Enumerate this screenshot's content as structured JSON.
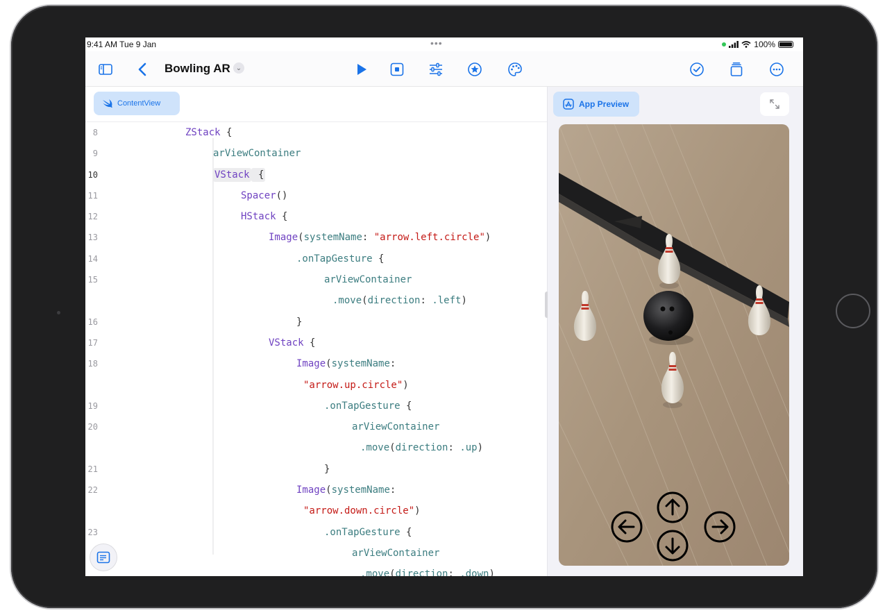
{
  "status_bar": {
    "time": "9:41 AM  Tue 9 Jan",
    "dots": "•••",
    "battery": "100%"
  },
  "toolbar": {
    "project_title": "Bowling AR",
    "icons": [
      "sidebar-icon",
      "back-chevron-icon",
      "play-icon",
      "stop-icon",
      "sliders-icon",
      "star-icon",
      "palette-icon",
      "checkmark-circle-icon",
      "stack-icon",
      "ellipsis-circle-icon"
    ]
  },
  "editor": {
    "tab_label": "ContentView",
    "current_line": "10",
    "lines": [
      {
        "num": "8",
        "indent": 0,
        "parts": [
          {
            "t": "ZStack",
            "c": "kw"
          },
          {
            "t": " {",
            "c": "plain"
          }
        ]
      },
      {
        "num": "9",
        "indent": 1,
        "parts": [
          {
            "t": "arViewContainer",
            "c": "var"
          }
        ]
      },
      {
        "num": "10",
        "indent": 1,
        "parts": [
          {
            "t": "VStack",
            "c": "kw",
            "hl": true
          },
          {
            "t": " {",
            "c": "plain",
            "hl": true
          }
        ]
      },
      {
        "num": "11",
        "indent": 2,
        "parts": [
          {
            "t": "Spacer",
            "c": "kw"
          },
          {
            "t": "()",
            "c": "plain"
          }
        ]
      },
      {
        "num": "12",
        "indent": 2,
        "parts": [
          {
            "t": "HStack",
            "c": "kw"
          },
          {
            "t": " {",
            "c": "plain"
          }
        ]
      },
      {
        "num": "13",
        "indent": 3,
        "parts": [
          {
            "t": "Image",
            "c": "kw"
          },
          {
            "t": "(",
            "c": "plain"
          },
          {
            "t": "systemName",
            "c": "var"
          },
          {
            "t": ": ",
            "c": "plain"
          },
          {
            "t": "\"arrow.left.circle\"",
            "c": "str"
          },
          {
            "t": ")",
            "c": "plain"
          }
        ]
      },
      {
        "num": "14",
        "indent": 4,
        "parts": [
          {
            "t": ".onTapGesture",
            "c": "var"
          },
          {
            "t": " {",
            "c": "plain"
          }
        ]
      },
      {
        "num": "15",
        "indent": 5,
        "parts": [
          {
            "t": "arViewContainer",
            "c": "var"
          }
        ]
      },
      {
        "num": "",
        "indent": 5.3,
        "parts": [
          {
            "t": ".move",
            "c": "var"
          },
          {
            "t": "(",
            "c": "plain"
          },
          {
            "t": "direction",
            "c": "var"
          },
          {
            "t": ": ",
            "c": "plain"
          },
          {
            "t": ".left",
            "c": "var"
          },
          {
            "t": ")",
            "c": "plain"
          }
        ]
      },
      {
        "num": "16",
        "indent": 4,
        "parts": [
          {
            "t": "}",
            "c": "plain"
          }
        ]
      },
      {
        "num": "17",
        "indent": 3,
        "parts": [
          {
            "t": "VStack",
            "c": "kw"
          },
          {
            "t": " {",
            "c": "plain"
          }
        ]
      },
      {
        "num": "18",
        "indent": 4,
        "parts": [
          {
            "t": "Image",
            "c": "kw"
          },
          {
            "t": "(",
            "c": "plain"
          },
          {
            "t": "systemName",
            "c": "var"
          },
          {
            "t": ":",
            "c": "plain"
          }
        ]
      },
      {
        "num": "",
        "indent": 4.25,
        "parts": [
          {
            "t": "\"arrow.up.circle\"",
            "c": "str"
          },
          {
            "t": ")",
            "c": "plain"
          }
        ]
      },
      {
        "num": "19",
        "indent": 5,
        "parts": [
          {
            "t": ".onTapGesture",
            "c": "var"
          },
          {
            "t": " {",
            "c": "plain"
          }
        ]
      },
      {
        "num": "20",
        "indent": 6,
        "parts": [
          {
            "t": "arViewContainer",
            "c": "var"
          }
        ]
      },
      {
        "num": "",
        "indent": 6.3,
        "parts": [
          {
            "t": ".move",
            "c": "var"
          },
          {
            "t": "(",
            "c": "plain"
          },
          {
            "t": "direction",
            "c": "var"
          },
          {
            "t": ": ",
            "c": "plain"
          },
          {
            "t": ".up",
            "c": "var"
          },
          {
            "t": ")",
            "c": "plain"
          }
        ]
      },
      {
        "num": "21",
        "indent": 5,
        "parts": [
          {
            "t": "}",
            "c": "plain"
          }
        ]
      },
      {
        "num": "22",
        "indent": 4,
        "parts": [
          {
            "t": "Image",
            "c": "kw"
          },
          {
            "t": "(",
            "c": "plain"
          },
          {
            "t": "systemName",
            "c": "var"
          },
          {
            "t": ":",
            "c": "plain"
          }
        ]
      },
      {
        "num": "",
        "indent": 4.25,
        "parts": [
          {
            "t": "\"arrow.down.circle\"",
            "c": "str"
          },
          {
            "t": ")",
            "c": "plain"
          }
        ]
      },
      {
        "num": "23",
        "indent": 5,
        "parts": [
          {
            "t": ".onTapGesture",
            "c": "var"
          },
          {
            "t": " {",
            "c": "plain"
          }
        ]
      },
      {
        "num": "",
        "indent": 6,
        "parts": [
          {
            "t": "arViewContainer",
            "c": "var"
          }
        ]
      },
      {
        "num": "",
        "indent": 6.3,
        "parts": [
          {
            "t": ".move",
            "c": "var"
          },
          {
            "t": "(",
            "c": "plain"
          },
          {
            "t": "direction",
            "c": "var"
          },
          {
            "t": ": ",
            "c": "plain"
          },
          {
            "t": ".down",
            "c": "var"
          },
          {
            "t": ")",
            "c": "plain"
          }
        ]
      }
    ]
  },
  "preview": {
    "chip_label": "App Preview",
    "controls": [
      "arrow-up-circle-icon",
      "arrow-left-circle-icon",
      "arrow-right-circle-icon",
      "arrow-down-circle-icon"
    ]
  },
  "colors": {
    "accent": "#1a73e8",
    "keyword": "#6f42c1",
    "identifier": "#3c7d80",
    "string": "#c41a16",
    "chip_bg": "#cfe3fb"
  }
}
